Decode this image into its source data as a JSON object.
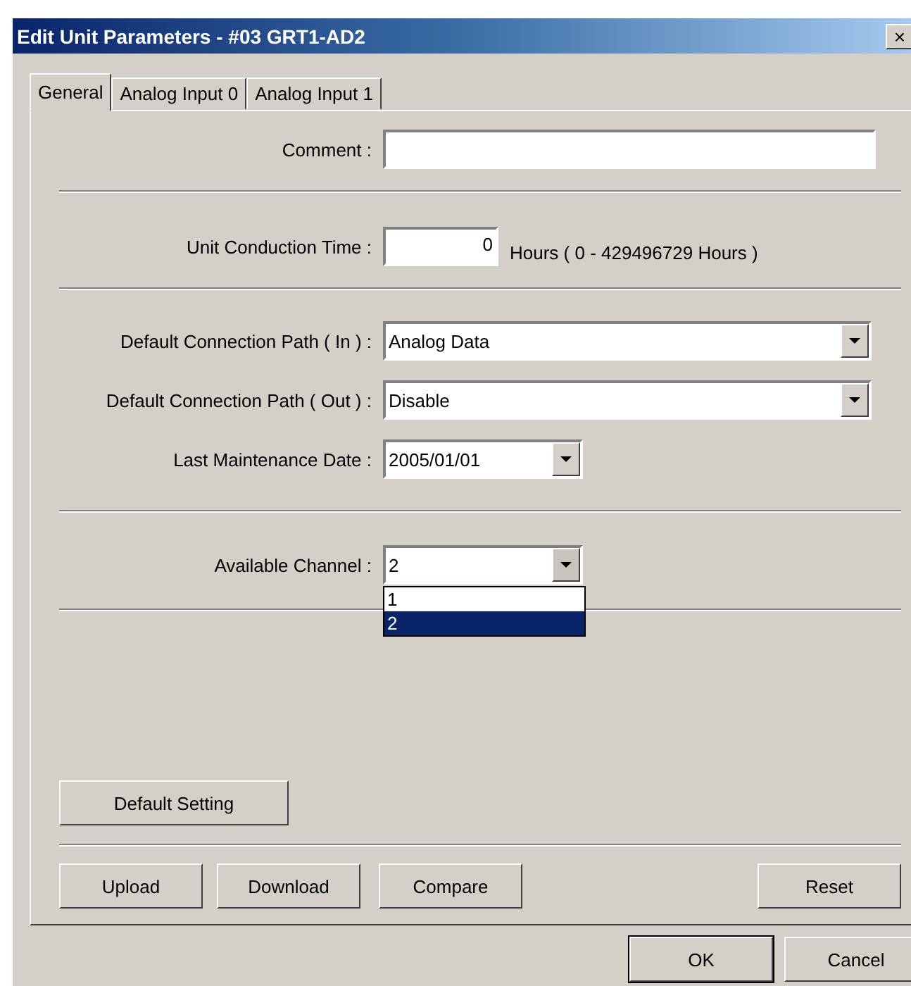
{
  "window": {
    "title": "Edit Unit Parameters - #03 GRT1-AD2",
    "close": "×"
  },
  "tabs": [
    {
      "label": "General",
      "selected": true
    },
    {
      "label": "Analog Input 0",
      "selected": false
    },
    {
      "label": "Analog Input 1",
      "selected": false
    }
  ],
  "comment": {
    "label": "Comment :"
  },
  "conduction": {
    "label": "Unit Conduction Time :",
    "value": "0",
    "note": "Hours ( 0 - 429496729 Hours )"
  },
  "paths": [
    {
      "label": "Default Connection Path ( In ) :",
      "value": "Analog Data"
    },
    {
      "label": "Default Connection Path ( Out ) :",
      "value": "Disable"
    }
  ],
  "maintenance": {
    "label": "Last Maintenance Date :",
    "value": "2005/01/01"
  },
  "channel": {
    "label": "Available Channel :",
    "value": "2",
    "expanded": true,
    "options": [
      {
        "label": "1",
        "selected": false
      },
      {
        "label": "2",
        "selected": true
      }
    ]
  },
  "default_button": "Default Setting",
  "action_buttons": [
    "Upload",
    "Download",
    "Compare"
  ],
  "reset_button": "Reset",
  "dialog_buttons": [
    {
      "label": "OK",
      "default": true
    },
    {
      "label": "Cancel",
      "default": false
    }
  ]
}
